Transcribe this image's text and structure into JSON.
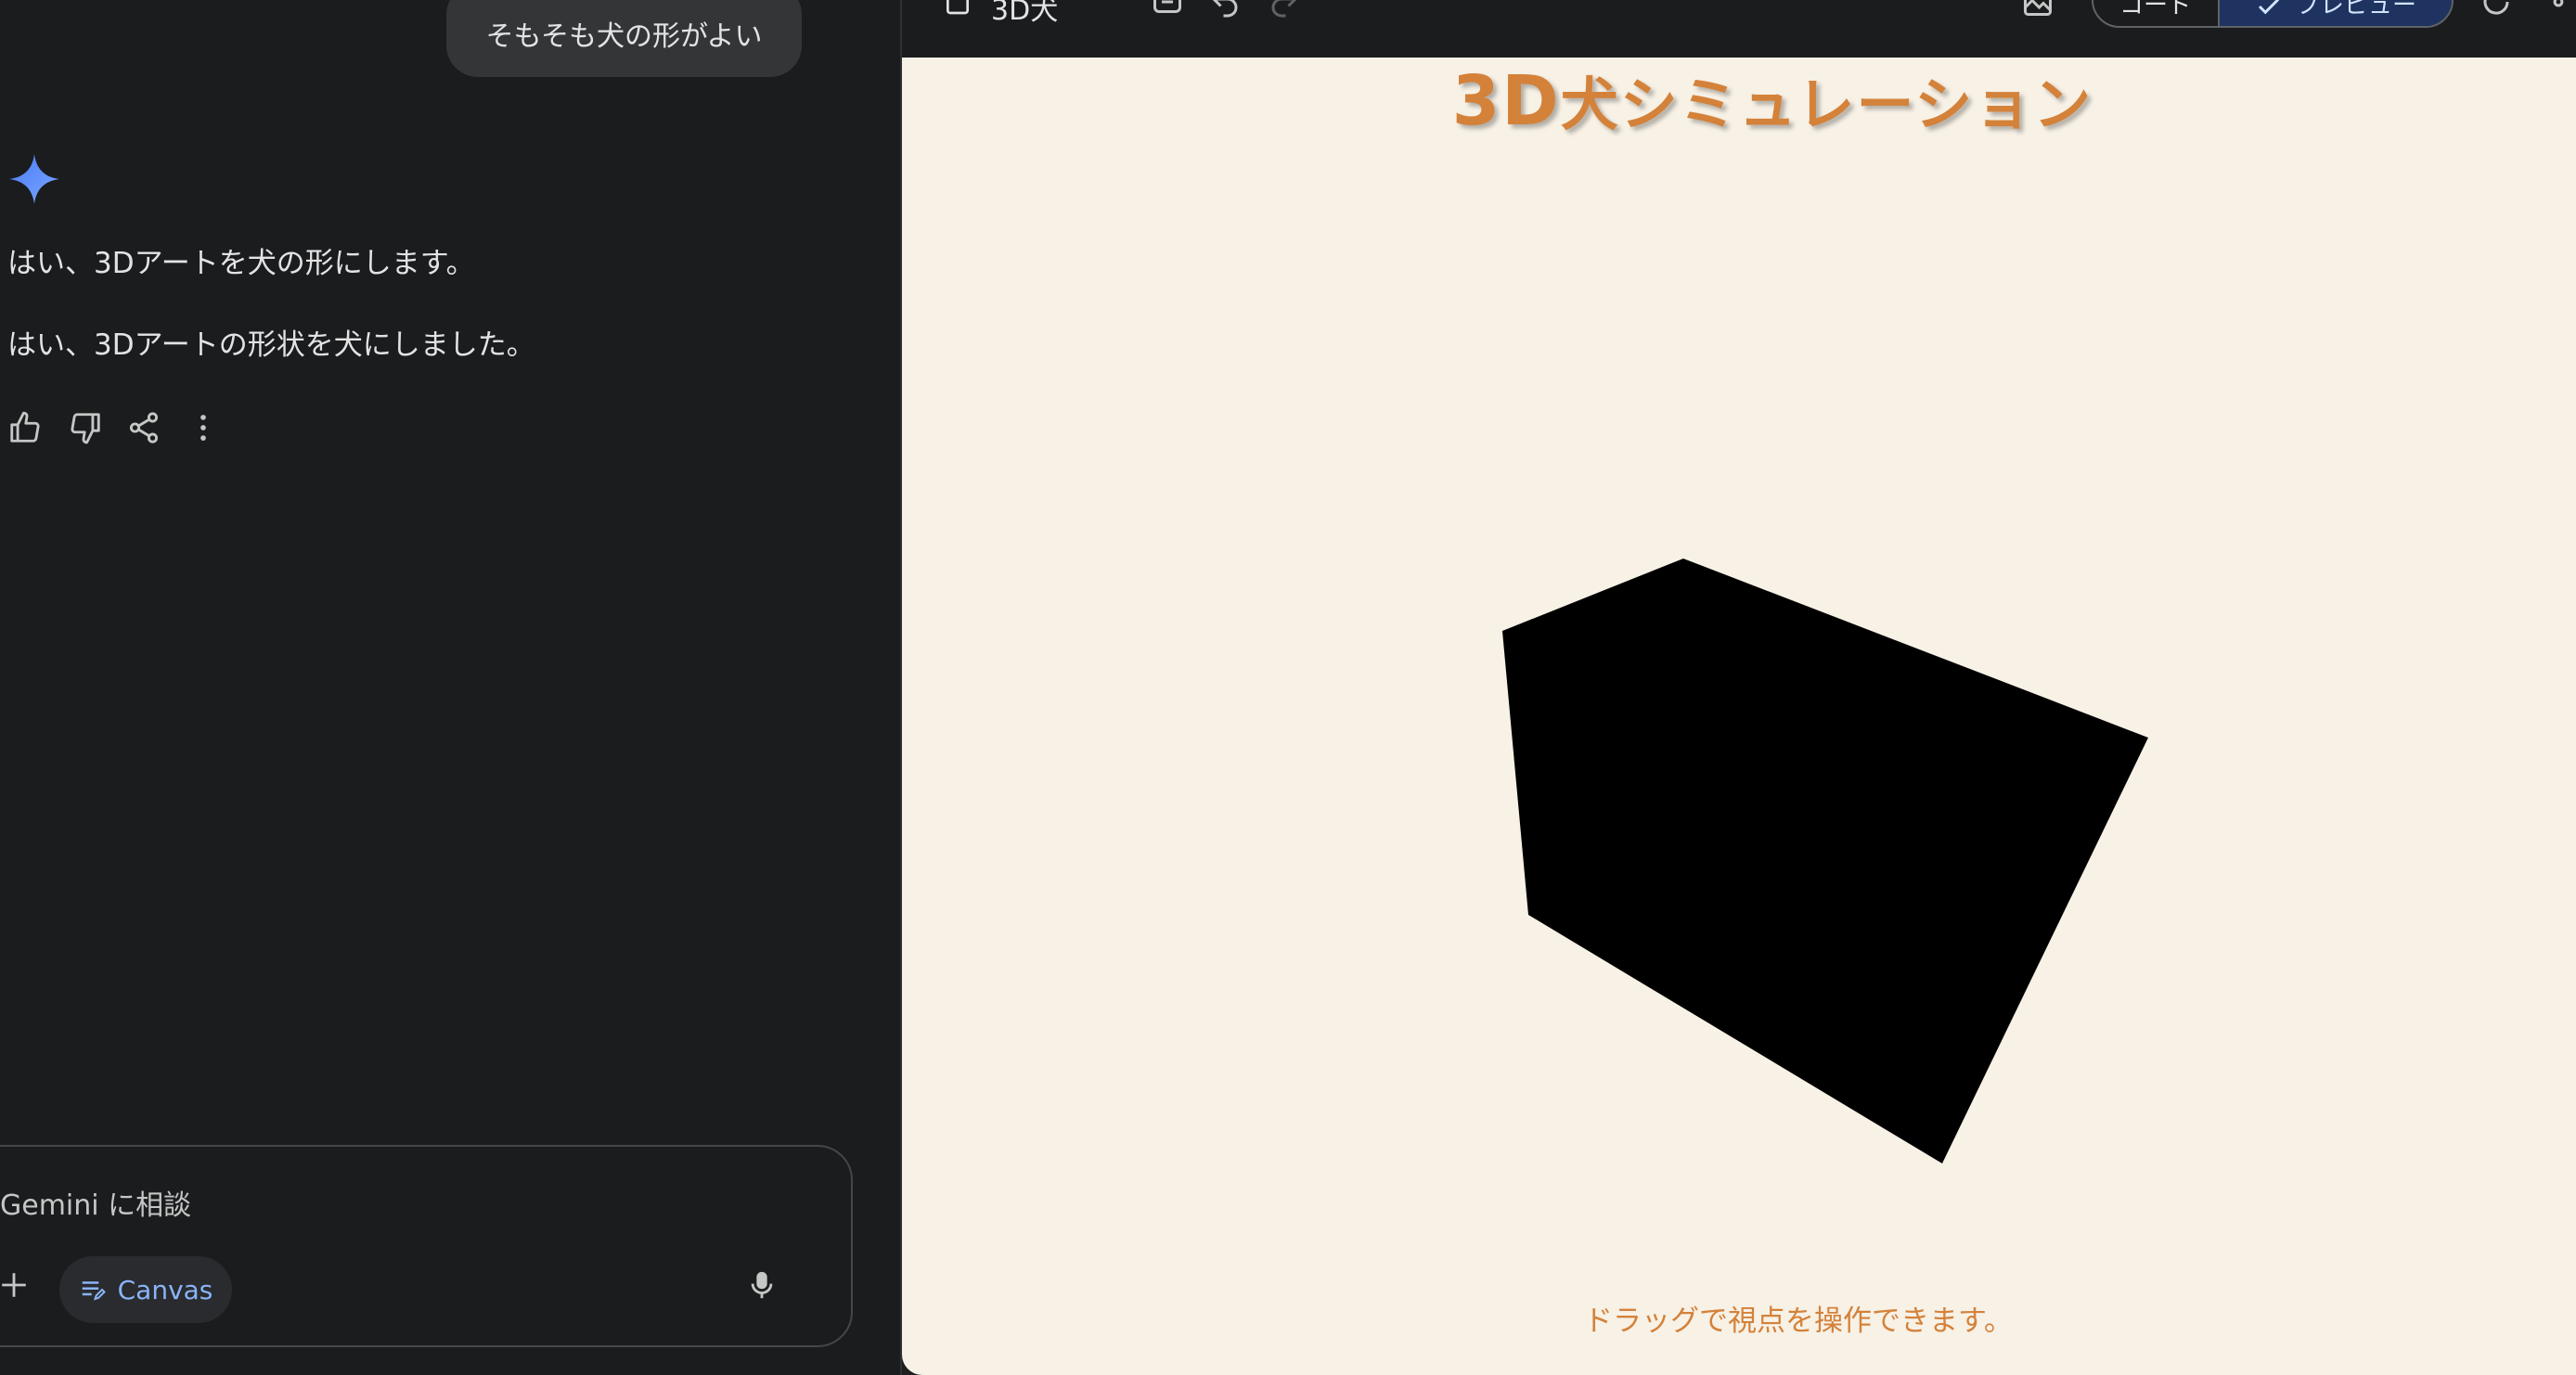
{
  "chat": {
    "user_message": "そもそも犬の形がよい",
    "reply_lines": [
      "はい、3Dアートを犬の形にします。",
      "はい、3Dアートの形状を犬にしました。"
    ],
    "actions": [
      "thumbs-up-icon",
      "thumbs-down-icon",
      "share-icon",
      "more-vert-icon"
    ],
    "composer": {
      "placeholder": "Gemini に相談",
      "canvas_chip": "Canvas"
    },
    "accent_color": "#8ab4f8"
  },
  "canvas": {
    "doc_title": "3D犬",
    "toggle": {
      "code": "コード",
      "preview": "プレビュー",
      "selected": "preview"
    },
    "preview": {
      "title_prefix": "3D",
      "title_rest": "犬シミュレーション",
      "hint": "ドラッグで視点を操作できます。",
      "title_color": "#d4823a",
      "background": "#f7f1e6",
      "object": "black-box"
    }
  }
}
